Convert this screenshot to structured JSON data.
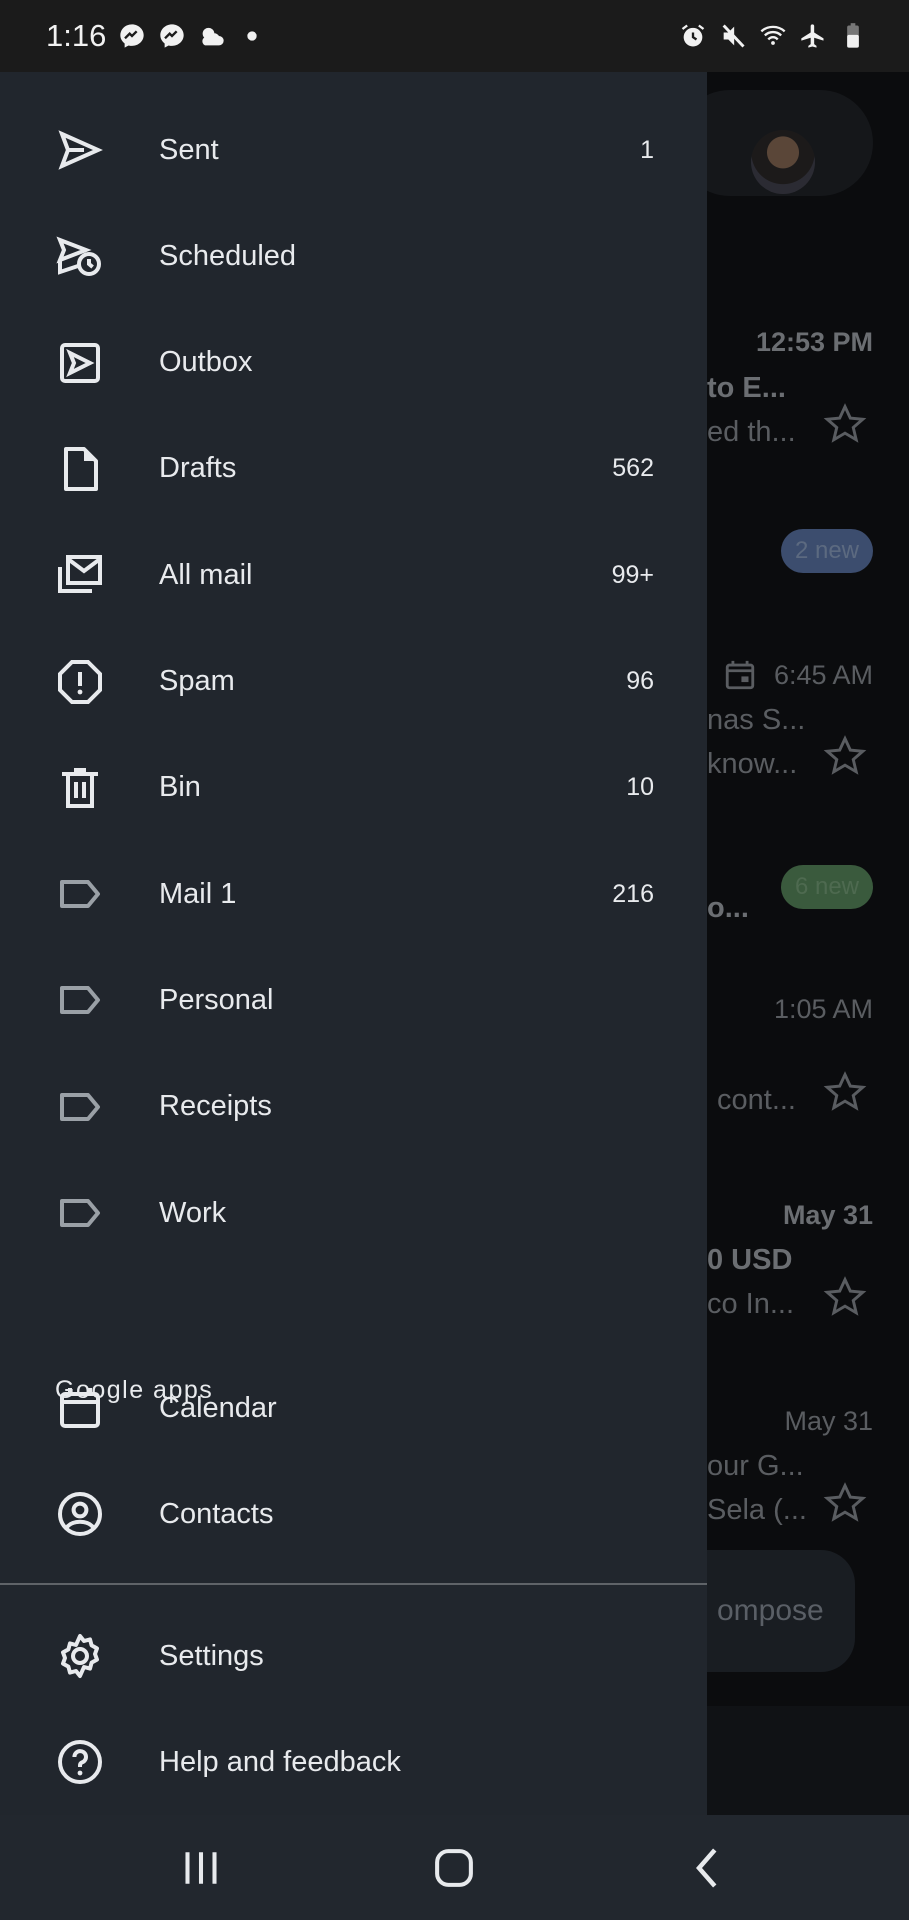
{
  "status_bar": {
    "time": "1:16",
    "left_icons": [
      "messenger-icon",
      "messenger-icon",
      "weather-icon",
      "dot-icon"
    ],
    "right_icons": [
      "alarm-icon",
      "mute-icon",
      "wifi-icon",
      "airplane-icon",
      "battery-icon"
    ]
  },
  "drawer": {
    "items": [
      {
        "label": "Sent",
        "count": "1",
        "icon": "send"
      },
      {
        "label": "Scheduled",
        "count": "",
        "icon": "scheduled"
      },
      {
        "label": "Outbox",
        "count": "",
        "icon": "outbox"
      },
      {
        "label": "Drafts",
        "count": "562",
        "icon": "draft"
      },
      {
        "label": "All mail",
        "count": "99+",
        "icon": "allmail"
      },
      {
        "label": "Spam",
        "count": "96",
        "icon": "spam"
      },
      {
        "label": "Bin",
        "count": "10",
        "icon": "bin"
      },
      {
        "label": "Mail 1",
        "count": "216",
        "icon": "label"
      },
      {
        "label": "Personal",
        "count": "",
        "icon": "label"
      },
      {
        "label": "Receipts",
        "count": "",
        "icon": "label"
      },
      {
        "label": "Work",
        "count": "",
        "icon": "label"
      }
    ],
    "google_apps_heading": "Google apps",
    "apps": [
      {
        "label": "Calendar",
        "icon": "calendar"
      },
      {
        "label": "Contacts",
        "icon": "contacts"
      }
    ],
    "footer": [
      {
        "label": "Settings",
        "icon": "settings"
      },
      {
        "label": "Help and feedback",
        "icon": "help"
      }
    ]
  },
  "background_inbox": {
    "texts": {
      "t1": "12:53 PM",
      "s1": "to E...",
      "p1": "ed th...",
      "badge1": "2 new",
      "t2": "6:45 AM",
      "s2": "nas S...",
      "p2": "know...",
      "badge2": "6 new",
      "s3": "o...",
      "t3": "1:05 AM",
      "p3": "cont...",
      "t4": "May 31",
      "s4": "0 USD",
      "p4": "co In...",
      "t5": "May 31",
      "s5": "our G...",
      "p5": "Sela (...",
      "compose": "ompose"
    },
    "badge1_color": "#3c4d6e",
    "badge2_color": "#3a5a3d"
  },
  "nav_bar": {
    "buttons": [
      "recents",
      "home",
      "back"
    ]
  }
}
